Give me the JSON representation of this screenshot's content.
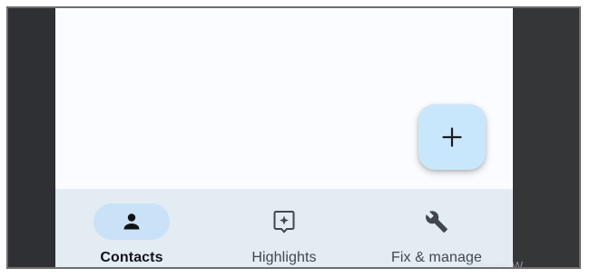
{
  "fab": {
    "icon": "plus-icon",
    "color": "#c9e7fc"
  },
  "nav": {
    "items": [
      {
        "label": "Contacts",
        "icon": "person-icon",
        "active": true
      },
      {
        "label": "Highlights",
        "icon": "sparkle-message-icon",
        "active": false
      },
      {
        "label": "Fix & manage",
        "icon": "wrench-icon",
        "active": false
      }
    ]
  },
  "watermark": "Activate W",
  "colors": {
    "nav_background": "#e3ebf3",
    "active_pill": "#c9e2f7",
    "side_bars": "#2f3033"
  }
}
